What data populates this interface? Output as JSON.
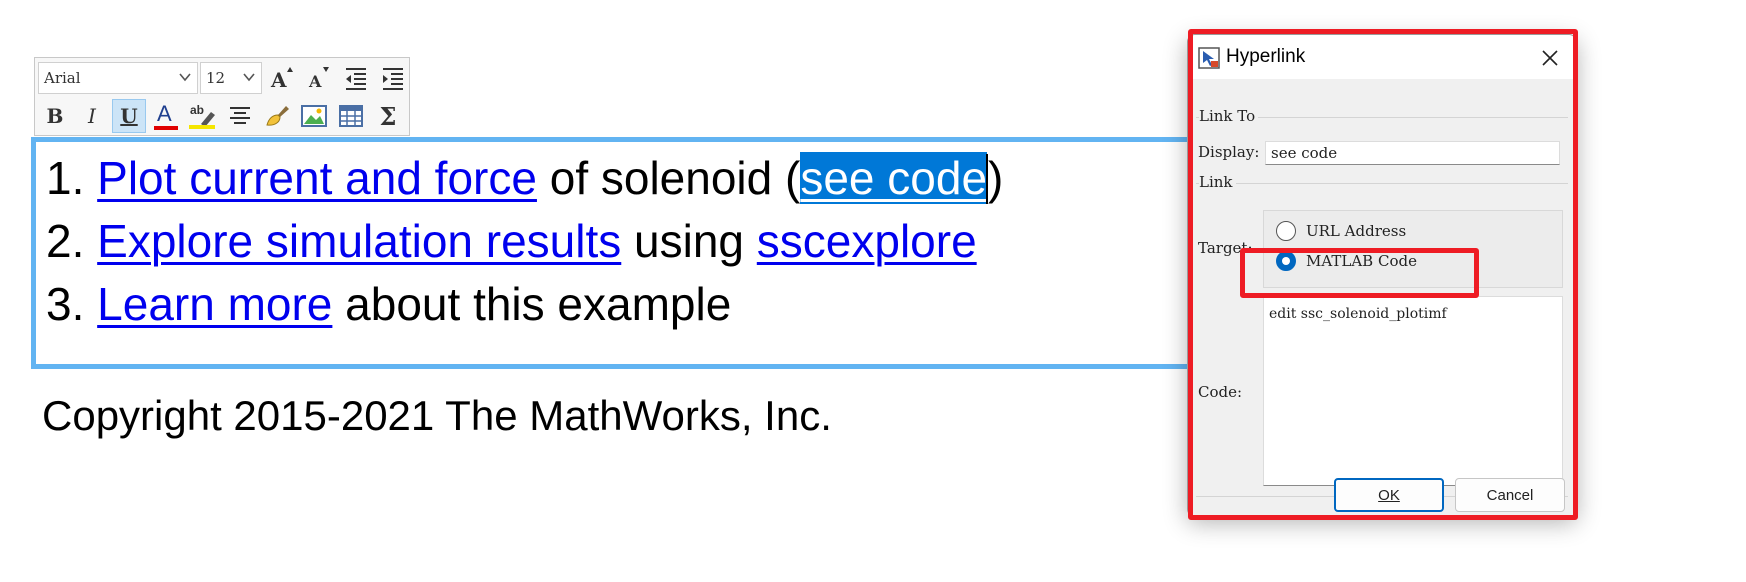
{
  "toolbar": {
    "font_name": "Arial",
    "font_size": "12",
    "buttons_row1": [
      "increase-font-size",
      "decrease-font-size",
      "decrease-indent",
      "increase-indent"
    ],
    "buttons_row2": [
      "bold",
      "italic",
      "underline",
      "font-color",
      "highlight",
      "align-center",
      "format-painter",
      "insert-image",
      "insert-table",
      "insert-equation"
    ],
    "bold_label": "B",
    "italic_label": "I",
    "underline_label": "U",
    "font_color_label": "A",
    "highlight_label": "ab",
    "sigma_label": "Σ",
    "increase_font_label": "A",
    "decrease_font_label": "A",
    "font_color_hex": "#e00000",
    "underline_active": true
  },
  "editor": {
    "lines": [
      {
        "number": "1.",
        "link": "Plot current and force",
        "text": "of solenoid",
        "paren_open": "(",
        "selected_link": "see code",
        "paren_close": ")"
      },
      {
        "number": "2.",
        "link": "Explore simulation results",
        "text": "using",
        "link2": "sscexplore"
      },
      {
        "number": "3.",
        "link": "Learn more",
        "text": "about this example"
      }
    ],
    "border_color": "#62b4f2",
    "link_color": "#0000ee",
    "selection_color": "#0078d7"
  },
  "copyright": "Copyright 2015-2021 The MathWorks, Inc.",
  "dialog": {
    "title": "Hyperlink",
    "link_to_legend": "Link To",
    "display_label": "Display:",
    "display_value": "see code",
    "link_legend": "Link",
    "target_label": "Target:",
    "target_options": [
      {
        "label": "URL Address",
        "selected": false
      },
      {
        "label": "MATLAB Code",
        "selected": true
      }
    ],
    "code_label": "Code:",
    "code_value": "edit ssc_solenoid_plotimf",
    "ok_label": "OK",
    "cancel_label": "Cancel"
  },
  "annotation_color": "#ee1c24"
}
